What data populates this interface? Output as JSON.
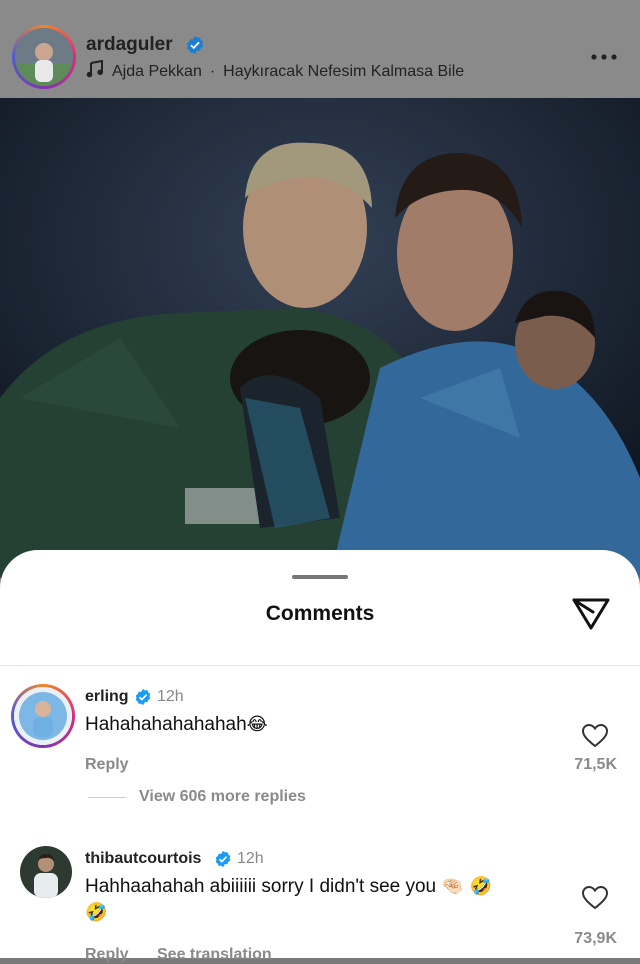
{
  "header": {
    "username": "ardaguler",
    "music_artist": "Ajda Pekkan",
    "music_separator": "·",
    "music_title": "Haykıracak Nefesim Kalmasa Bile"
  },
  "sheet": {
    "title": "Comments"
  },
  "comments": [
    {
      "username": "erling",
      "time": "12h",
      "text": "Hahahahahahahah",
      "emoji": "😂",
      "reply_label": "Reply",
      "likes": "71,5K",
      "more_replies": "View 606 more replies"
    },
    {
      "username": "thibautcourtois",
      "time": "12h",
      "text": "Hahhaahahah abiiiiii sorry I didn't see you",
      "emoji_line1": "🤏🏻 🤣",
      "emoji_line2": "🤣",
      "reply_label": "Reply",
      "translate_label": "See translation",
      "likes": "73,9K"
    }
  ],
  "colors": {
    "verified": "#1d9bf0",
    "sheet_bg": "#ffffff",
    "overlay_header": "#8a8a8a"
  }
}
